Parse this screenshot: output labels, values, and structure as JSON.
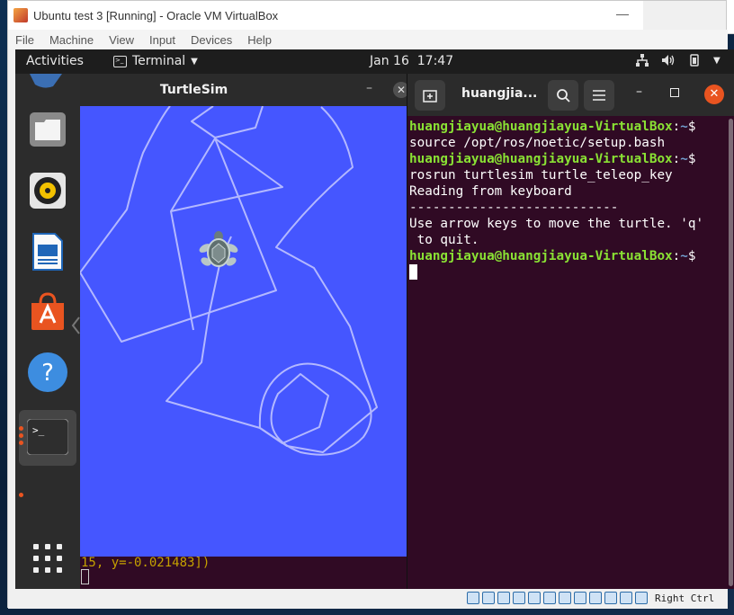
{
  "vbox": {
    "title": "Ubuntu test 3 [Running] - Oracle VM VirtualBox",
    "minimize": "—",
    "menu": [
      "File",
      "Machine",
      "View",
      "Input",
      "Devices",
      "Help"
    ],
    "host_key": "Right Ctrl"
  },
  "topbar": {
    "activities": "Activities",
    "app_menu": "Terminal",
    "date": "Jan 16",
    "time": "17:47"
  },
  "dock": {
    "items": [
      "files-icon",
      "rhythmbox-icon",
      "writer-icon",
      "software-icon",
      "help-icon",
      "terminal-icon"
    ],
    "apps_grid": "show-applications-icon"
  },
  "turtlesim": {
    "title": "TurtleSim",
    "min": "–",
    "close": "✕",
    "background_color": "#4556ff",
    "path_color": "#b3b8ff"
  },
  "bg_terminal": {
    "text": "15, y=-0.021483])"
  },
  "terminal": {
    "title": "huangjia...",
    "lines": [
      {
        "user": "huangjiayua@huangjiayua-VirtualBox",
        "sep": ":",
        "path": "~",
        "sym": "$",
        "cmd": ""
      },
      {
        "text": "source /opt/ros/noetic/setup.bash"
      },
      {
        "user": "huangjiayua@huangjiayua-VirtualBox",
        "sep": ":",
        "path": "~",
        "sym": "$",
        "cmd": ""
      },
      {
        "text": "rosrun turtlesim turtle_teleop_key"
      },
      {
        "text": "Reading from keyboard"
      },
      {
        "text": "---------------------------"
      },
      {
        "text": "Use arrow keys to move the turtle. 'q'"
      },
      {
        "text": " to quit."
      },
      {
        "user": "huangjiayua@huangjiayua-VirtualBox",
        "sep": ":",
        "path": "~",
        "sym": "$",
        "cmd": ""
      }
    ]
  }
}
